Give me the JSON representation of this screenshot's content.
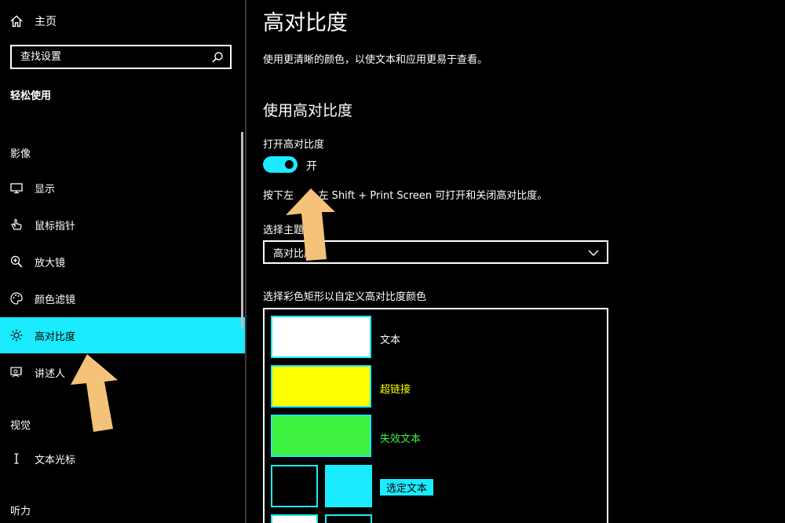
{
  "sidebar": {
    "home_label": "主页",
    "search_placeholder": "查找设置",
    "section_title": "轻松使用",
    "groups": {
      "vision": "影像",
      "interaction": "视觉",
      "hearing": "听力"
    },
    "items": [
      {
        "label": "显示",
        "icon": "monitor-icon"
      },
      {
        "label": "鼠标指针",
        "icon": "mouse-pointer-icon"
      },
      {
        "label": "放大镜",
        "icon": "magnifier-icon"
      },
      {
        "label": "颜色滤镜",
        "icon": "palette-icon"
      },
      {
        "label": "高对比度",
        "icon": "sun-icon",
        "active": true
      },
      {
        "label": "讲述人",
        "icon": "narrator-icon"
      },
      {
        "label": "文本光标",
        "icon": "text-cursor-icon"
      }
    ]
  },
  "main": {
    "title": "高对比度",
    "description": "使用更清晰的颜色，以使文本和应用更易于查看。",
    "subtitle": "使用高对比度",
    "toggle_label": "打开高对比度",
    "toggle_state": "开",
    "toggle_on": true,
    "shortcut_text": "按下左    + 左 Shift + Print Screen 可打开和关闭高对比度。",
    "theme_label": "选择主题",
    "theme_value": "高对比度",
    "color_label": "选择彩色矩形以自定义高对比度颜色",
    "colors": {
      "text": {
        "label": "文本",
        "color": "#ffffff"
      },
      "hyperlink": {
        "label": "超链接",
        "color": "#ffff00"
      },
      "disabled": {
        "label": "失效文本",
        "color": "#3ff23f"
      },
      "selected": {
        "label": "选定文本",
        "bg": "#000000",
        "fg": "#1aebff"
      }
    }
  },
  "accent_color": "#1aebff",
  "annotation_color": "#f5c27a"
}
